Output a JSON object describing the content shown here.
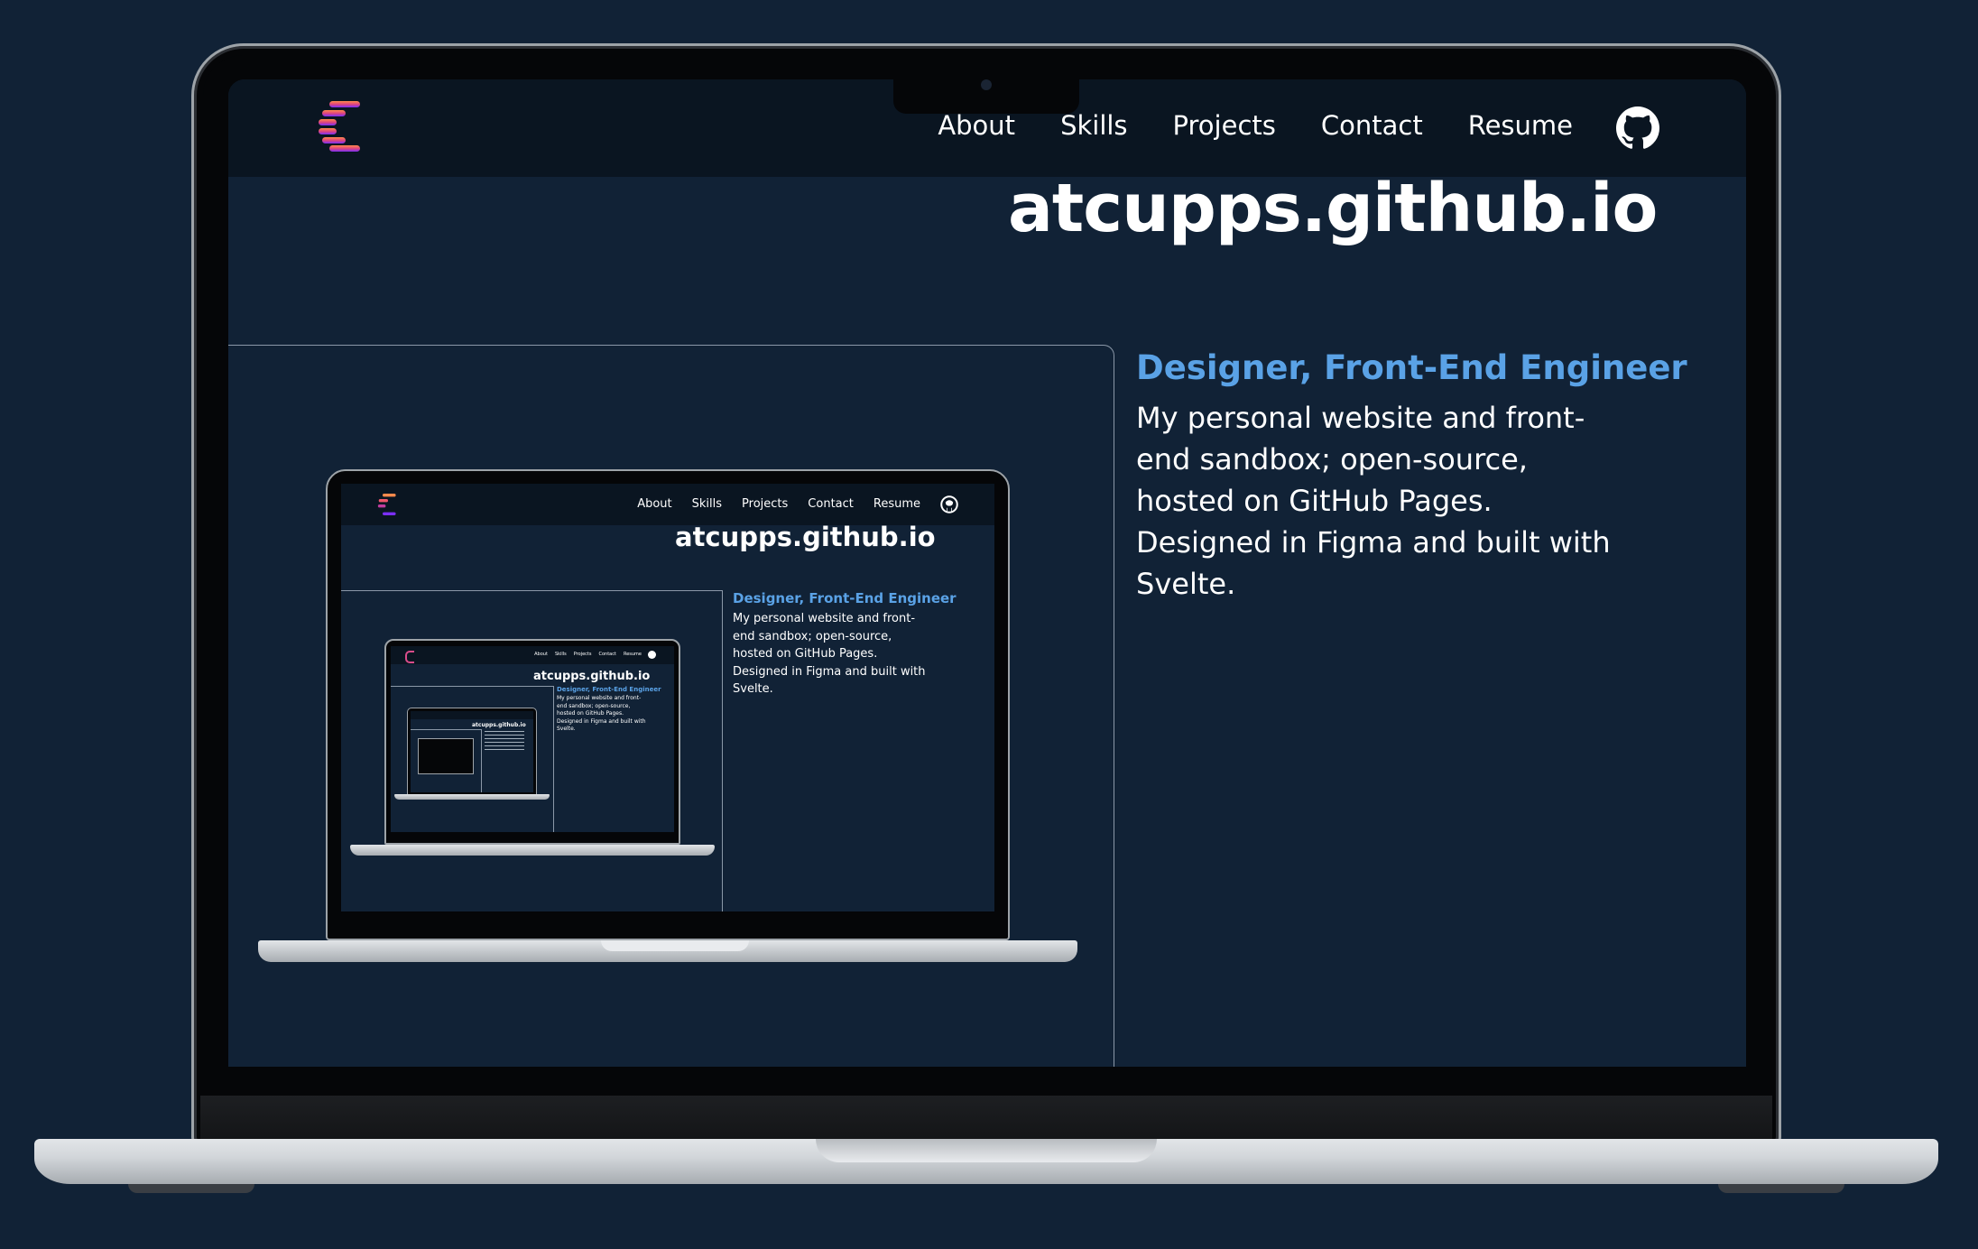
{
  "nav": {
    "logo_icon": "c-logo-icon",
    "links": [
      "About",
      "Skills",
      "Projects",
      "Contact",
      "Resume"
    ],
    "github_icon": "github-icon"
  },
  "hero": {
    "title": "atcupps.github.io",
    "subtitle": "Designer, Front-End Engineer",
    "description_lines": [
      "My personal website and front-",
      "end sandbox; open-source,",
      "hosted on GitHub Pages.",
      "Designed in Figma and built with",
      "Svelte."
    ]
  },
  "colors": {
    "background": "#112236",
    "nav_background": "#0a1521",
    "accent": "#5aa2e6",
    "logo_top": "#ff8a4c",
    "logo_bottom": "#7b2ff7"
  }
}
